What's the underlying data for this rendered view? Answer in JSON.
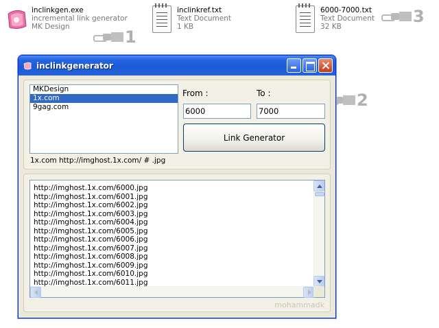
{
  "files": [
    {
      "name": "inclinkgen.exe",
      "type": "incremental link generator",
      "detail": "MK Design",
      "icon": "application-icon"
    },
    {
      "name": "inclinkref.txt",
      "type": "Text Document",
      "detail": "1 KB",
      "icon": "text-document-icon"
    },
    {
      "name": "6000-7000.txt",
      "type": "Text Document",
      "detail": "32 KB",
      "icon": "text-document-icon"
    }
  ],
  "markers": {
    "one": "1",
    "two": "2",
    "three": "3"
  },
  "window": {
    "title": "inclinkgenerator",
    "sites": [
      "MKDesign",
      "1x.com",
      "9gag.com"
    ],
    "selected_site": "1x.com",
    "from_label": "From :",
    "to_label": "To :",
    "from_value": "6000",
    "to_value": "7000",
    "generate_label": "Link Generator",
    "pattern_preview": "1x.com http://imghost.1x.com/ # .jpg",
    "output_lines": [
      "http://imghost.1x.com/6000.jpg",
      "http://imghost.1x.com/6001.jpg",
      "http://imghost.1x.com/6002.jpg",
      "http://imghost.1x.com/6003.jpg",
      "http://imghost.1x.com/6004.jpg",
      "http://imghost.1x.com/6005.jpg",
      "http://imghost.1x.com/6006.jpg",
      "http://imghost.1x.com/6007.jpg",
      "http://imghost.1x.com/6008.jpg",
      "http://imghost.1x.com/6009.jpg",
      "http://imghost.1x.com/6010.jpg",
      "http://imghost.1x.com/6011.jpg"
    ],
    "watermark": "mohammadk"
  },
  "colors": {
    "titlebar": "#2462d8",
    "selection": "#316ac5",
    "close": "#c7391b"
  }
}
